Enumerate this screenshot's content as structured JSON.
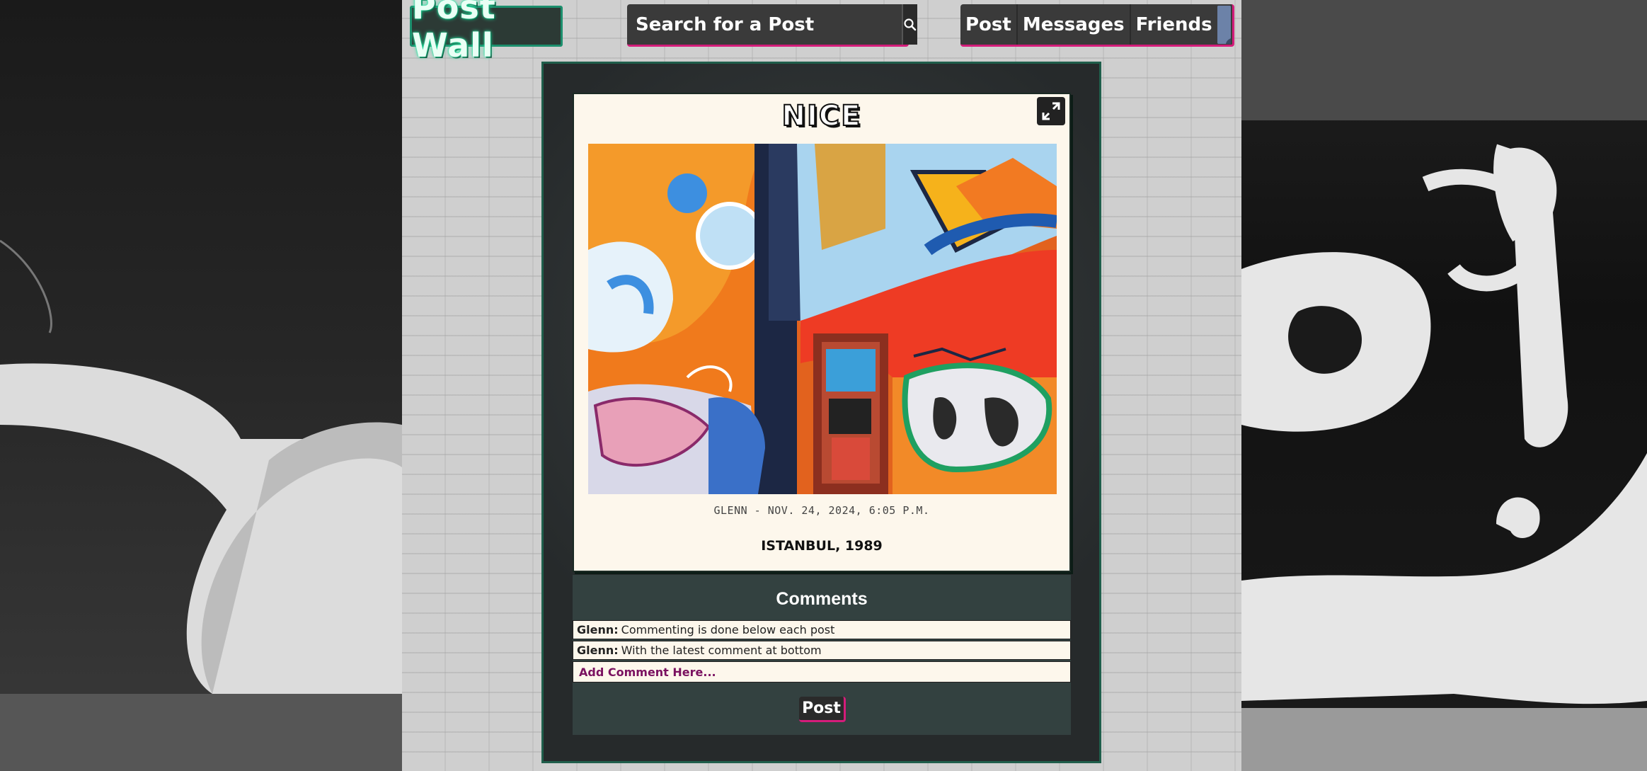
{
  "header": {
    "logo_text": "Post Wall",
    "search": {
      "placeholder": "Search for a Post"
    },
    "nav": [
      {
        "label": "Post"
      },
      {
        "label": "Messages"
      },
      {
        "label": "Friends"
      }
    ]
  },
  "post": {
    "title": "NICE",
    "meta": "GLENN - NOV. 24, 2024, 6:05 P.M.",
    "caption": "ISTANBUL, 1989"
  },
  "comments": {
    "heading": "Comments",
    "items": [
      {
        "author": "Glenn:",
        "text": "Commenting is done below each post"
      },
      {
        "author": "Glenn:",
        "text": "With the latest comment at bottom"
      }
    ],
    "input_placeholder": "Add Comment Here...",
    "post_label": "Post"
  },
  "colors": {
    "accent": "#d41c7a",
    "logo_glow": "#27e6a3",
    "panel_border": "#1f5e4b"
  }
}
